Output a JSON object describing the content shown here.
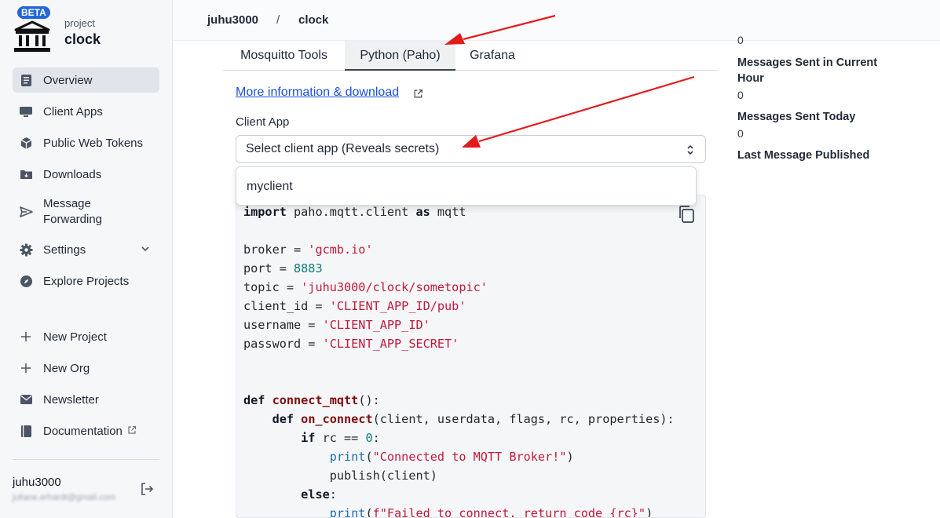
{
  "brand": {
    "badge": "BETA",
    "label": "project",
    "name": "clock"
  },
  "nav": {
    "overview": "Overview",
    "client_apps": "Client Apps",
    "public_web_tokens": "Public Web Tokens",
    "downloads": "Downloads",
    "message_forwarding": "Message Forwarding",
    "settings": "Settings",
    "explore_projects": "Explore Projects",
    "new_project": "New Project",
    "new_org": "New Org",
    "newsletter": "Newsletter",
    "documentation": "Documentation"
  },
  "user": {
    "name": "juhu3000",
    "email": "juliane.erhardt@gmail.com"
  },
  "breadcrumb": {
    "org": "juhu3000",
    "sep": "/",
    "project": "clock"
  },
  "tabs": [
    "Mosquitto Tools",
    "Python (Paho)",
    "Grafana"
  ],
  "active_tab": "Python (Paho)",
  "panel": {
    "info_link": "More information & download",
    "client_label": "Client App",
    "select_placeholder": "Select client app (Reveals secrets)",
    "dropdown_option": "myclient"
  },
  "code": {
    "l1_kw1": "import",
    "l1_mid": " paho.mqtt.client ",
    "l1_kw2": "as",
    "l1_end": " mqtt",
    "broker_lhs": "broker = ",
    "broker_val": "'gcmb.io'",
    "port_lhs": "port = ",
    "port_val": "8883",
    "topic_lhs": "topic = ",
    "topic_val": "'juhu3000/clock/sometopic'",
    "client_id_lhs": "client_id = ",
    "client_id_val": "'CLIENT_APP_ID/pub'",
    "username_lhs": "username = ",
    "username_val": "'CLIENT_APP_ID'",
    "password_lhs": "password = ",
    "password_val": "'CLIENT_APP_SECRET'",
    "def": "def",
    "fn1": "connect_mqtt",
    "fn1_rest": "():",
    "fn2": "on_connect",
    "fn2_rest": "(client, userdata, flags, rc, properties):",
    "if": "if",
    "if_cond": " rc == ",
    "if_num": "0",
    "if_colon": ":",
    "print": "print",
    "msg1": "\"Connected to MQTT Broker!\"",
    "publish": "publish(client)",
    "else": "else",
    "colon": ":",
    "msg2": "f\"Failed to connect, return code {rc}\""
  },
  "stats": {
    "top_value": "0",
    "hour_label": "Messages Sent in Current Hour",
    "hour_value": "0",
    "today_label": "Messages Sent Today",
    "today_value": "0",
    "last_label": "Last Message Published"
  },
  "colors": {
    "accent": "#2167d8",
    "link": "#1d4fd8",
    "annotation_arrow": "#e31b1b"
  }
}
